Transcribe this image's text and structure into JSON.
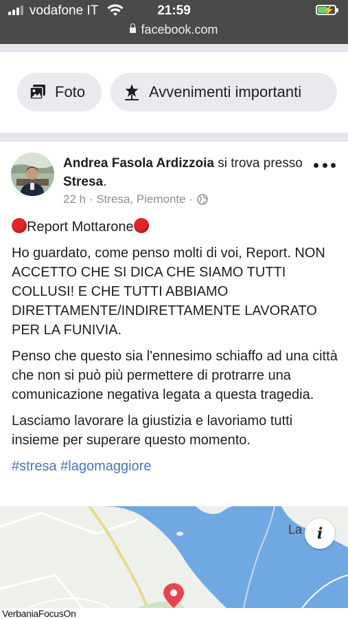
{
  "status_bar": {
    "carrier": "vodafone IT",
    "time": "21:59",
    "url": "facebook.com",
    "battery_level": 0.55
  },
  "actions": {
    "photo_label": "Foto",
    "events_label": "Avvenimenti importanti"
  },
  "post": {
    "author": "Andrea Fasola Ardizzoia",
    "checkin_text": " si trova presso ",
    "place": "Stresa",
    "place_suffix": ".",
    "time_ago": "22 h",
    "location": "Stresa, Piemonte",
    "title": "Report Mottarone",
    "paragraphs": [
      "Ho guardato, come penso molti di voi, Report. NON ACCETTO CHE SI DICA CHE SIAMO TUTTI COLLUSI! E CHE TUTTI ABBIAMO DIRETTAMENTE/INDIRETTAMENTE LAVORATO PER LA FUNIVIA.",
      "Penso che questo sia l'ennesimo schiaffo ad una città che non si può più permettere di protrarre una comunicazione negativa legata a questa tragedia.",
      "Lasciamo lavorare la giustizia e lavoriamo tutti insieme per superare questo momento."
    ],
    "hashtags": "#stresa #lagomaggiore"
  },
  "map": {
    "label": "La",
    "info_glyph": "i"
  },
  "watermark": "VerbaniaFocusOn"
}
